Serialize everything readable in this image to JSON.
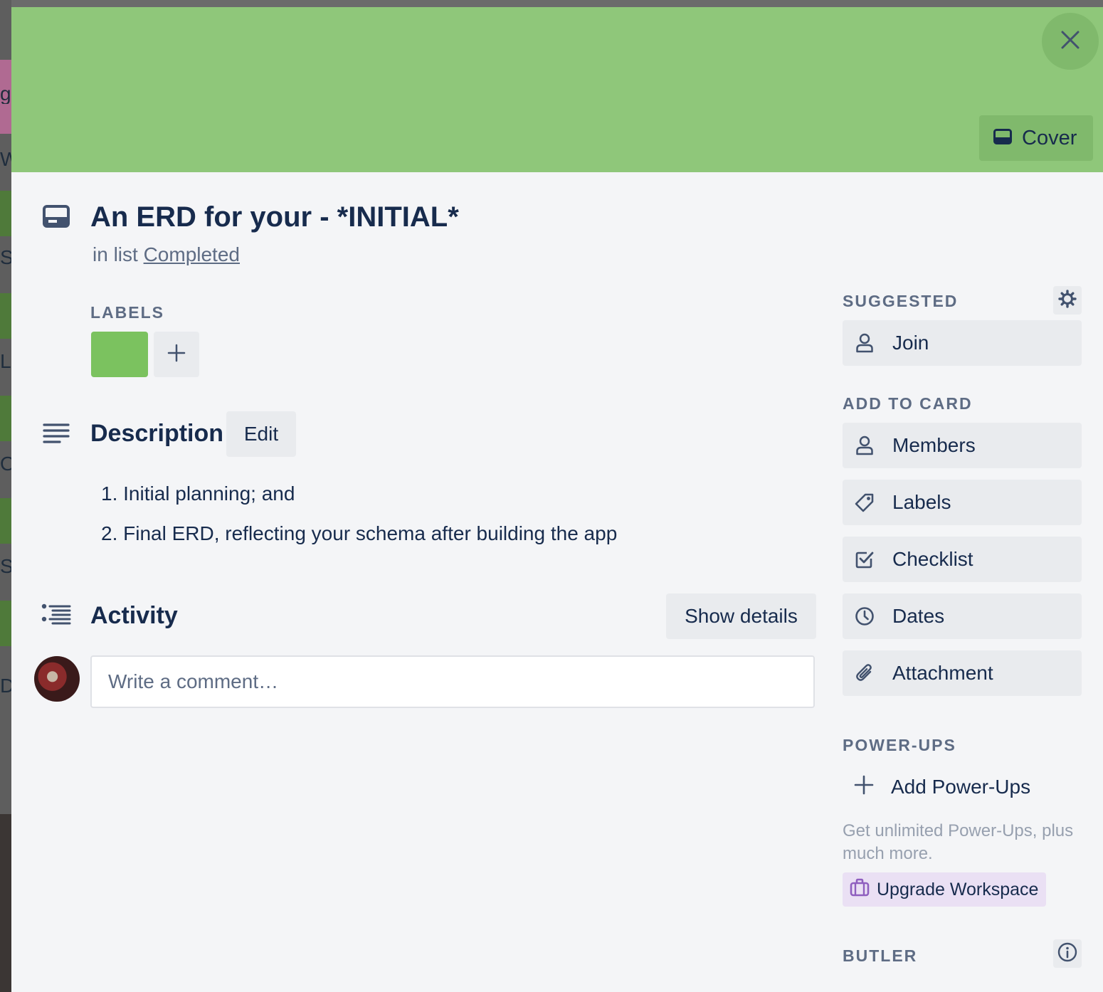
{
  "card": {
    "title": "An ERD for your - *INITIAL*",
    "in_list_prefix": "in list",
    "list_name": "Completed",
    "cover_color": "#8fc77a",
    "cover_button": "Cover"
  },
  "labels": {
    "heading": "LABELS",
    "items": [
      {
        "color": "#7bc25f"
      }
    ]
  },
  "description": {
    "heading": "Description",
    "edit_label": "Edit",
    "items": [
      "1. Initial planning; and",
      "2. Final ERD, reflecting your schema after building the app"
    ]
  },
  "activity": {
    "heading": "Activity",
    "show_details_label": "Show details",
    "comment_placeholder": "Write a comment…"
  },
  "sidebar": {
    "suggested_heading": "SUGGESTED",
    "join_label": "Join",
    "add_to_card_heading": "ADD TO CARD",
    "add_to_card": [
      {
        "label": "Members",
        "icon": "person-icon"
      },
      {
        "label": "Labels",
        "icon": "tag-icon"
      },
      {
        "label": "Checklist",
        "icon": "checklist-icon"
      },
      {
        "label": "Dates",
        "icon": "clock-icon"
      },
      {
        "label": "Attachment",
        "icon": "paperclip-icon"
      }
    ],
    "powerups_heading": "POWER-UPS",
    "add_powerups_label": "Add Power-Ups",
    "powerups_note": "Get unlimited Power-Ups, plus much more.",
    "upgrade_label": "Upgrade Workspace",
    "butler_heading": "BUTLER"
  },
  "background_board": {
    "visible_letters": [
      "g",
      "W",
      "S",
      "L",
      "O",
      "S",
      "D"
    ]
  }
}
